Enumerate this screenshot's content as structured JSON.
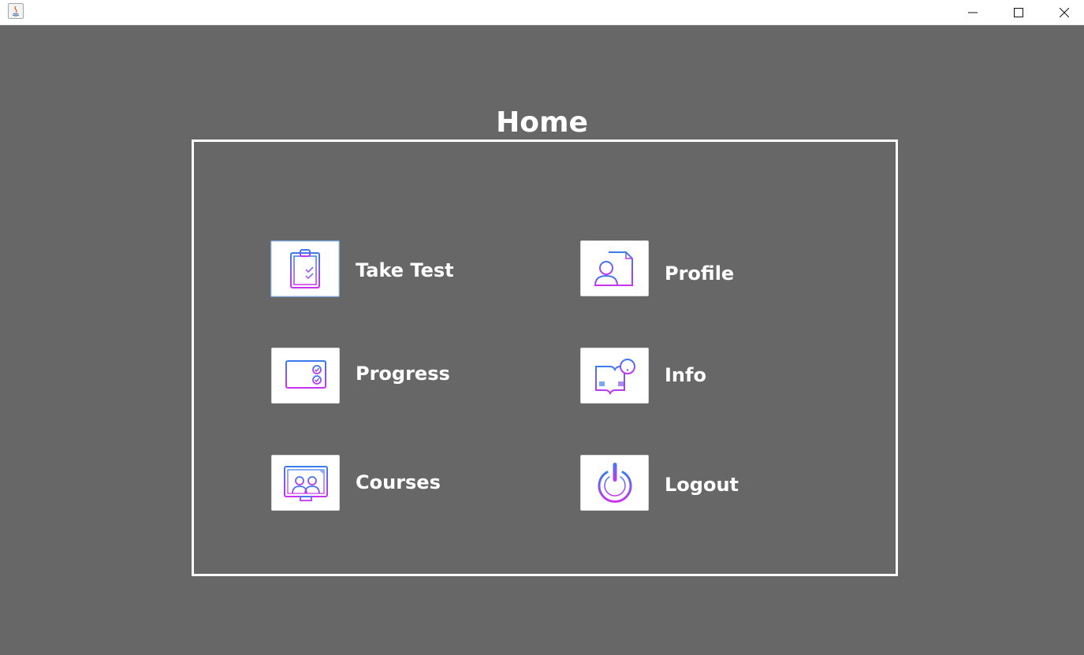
{
  "window": {
    "controls": {
      "minimize_icon": "minimize-icon",
      "maximize_icon": "maximize-icon",
      "close_icon": "close-icon"
    },
    "app_icon": "java-app-icon"
  },
  "home": {
    "title": "Home",
    "items": [
      {
        "label": "Take Test",
        "icon": "clipboard-checklist-icon"
      },
      {
        "label": "Profile",
        "icon": "user-document-icon"
      },
      {
        "label": "Progress",
        "icon": "progress-report-icon"
      },
      {
        "label": "Info",
        "icon": "book-info-icon"
      },
      {
        "label": "Courses",
        "icon": "classroom-screen-icon"
      },
      {
        "label": "Logout",
        "icon": "power-icon"
      }
    ]
  },
  "colors": {
    "background": "#676767",
    "icon_gradient_start": "#3b7bf0",
    "icon_gradient_end": "#c933f0",
    "frame": "#ffffff"
  }
}
